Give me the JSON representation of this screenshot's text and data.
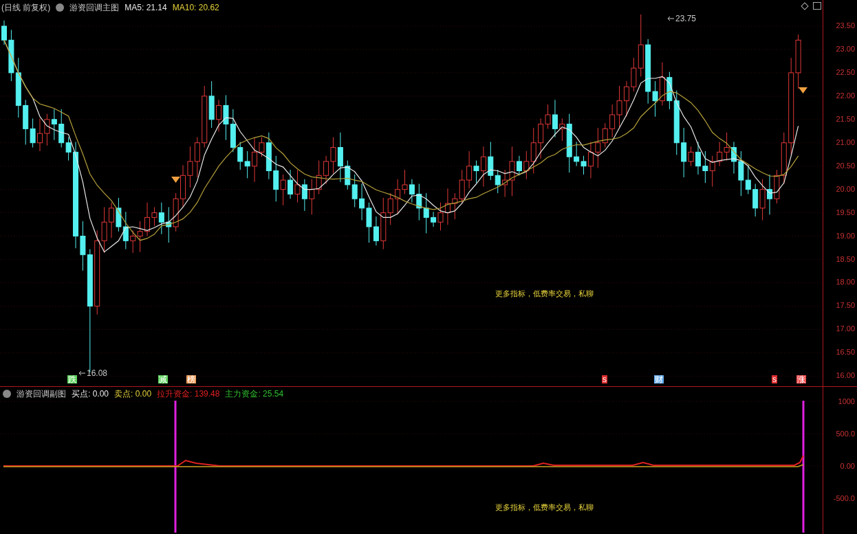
{
  "main_panel": {
    "period": "(日线 前复权)",
    "title": "游资回调主图",
    "indicators": [
      {
        "label": "MA5: 21.14",
        "color": "#e8e8e8"
      },
      {
        "label": "MA10: 20.62",
        "color": "#e6d23c"
      }
    ],
    "high_label": "23.75",
    "low_label": "16.08",
    "signals": [
      {
        "text": "跌",
        "color": "#5fd35f"
      },
      {
        "text": "减",
        "color": "#5fd35f"
      },
      {
        "text": "榜",
        "color": "#f0a060"
      },
      {
        "text": "s",
        "color": "#e03030"
      },
      {
        "text": "财",
        "color": "#6ab0f0"
      },
      {
        "text": "s",
        "color": "#e03030"
      },
      {
        "text": "涨",
        "color": "#f05050"
      }
    ],
    "note": "更多指标，低费率交易，私聊",
    "axis_ticks": [
      "23.50",
      "23.00",
      "22.50",
      "22.00",
      "21.50",
      "21.00",
      "20.50",
      "20.00",
      "19.50",
      "19.00",
      "18.50",
      "18.00",
      "17.50",
      "17.00",
      "16.50",
      "16.00"
    ]
  },
  "sub_panel": {
    "title": "游资回调副图",
    "indicators": [
      {
        "label": "买点: 0.00",
        "color": "#e8e8e8"
      },
      {
        "label": "卖点: 0.00",
        "color": "#e6d23c"
      },
      {
        "label": "拉升资金: 139.48",
        "color": "#e02020"
      },
      {
        "label": "主力资金: 25.54",
        "color": "#30c030"
      }
    ],
    "note": "更多指标，低费率交易，私聊",
    "axis_ticks": [
      "1000",
      "500.0",
      "0.00",
      "-500.0"
    ]
  }
}
